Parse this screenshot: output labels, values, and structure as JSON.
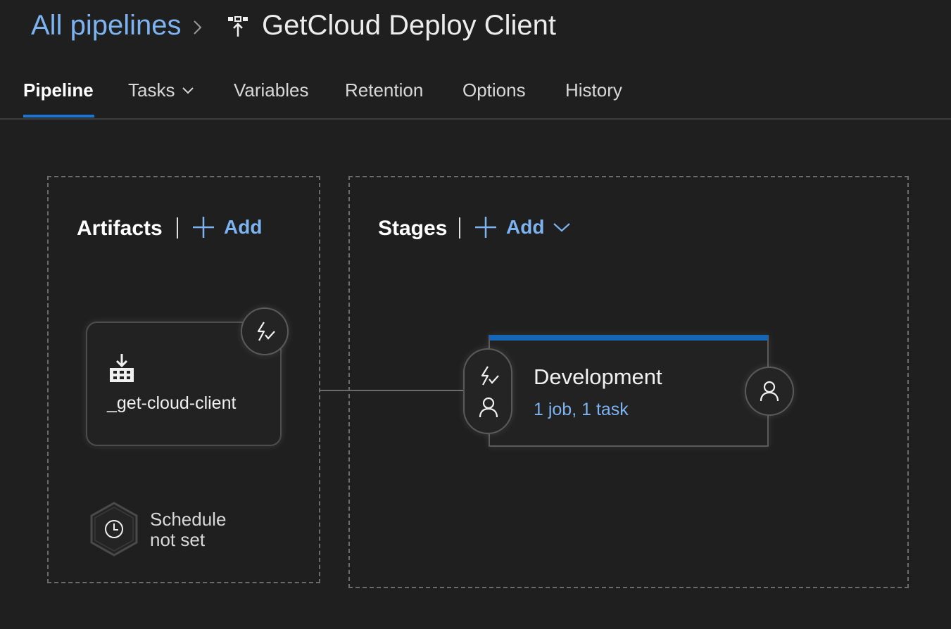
{
  "breadcrumb": {
    "root_label": "All pipelines",
    "separator_icon": "chevron-right-icon",
    "pipeline_icon": "release-pipeline-icon",
    "title": "GetCloud Deploy Client"
  },
  "tabs": [
    {
      "label": "Pipeline",
      "active": true
    },
    {
      "label": "Tasks",
      "has_dropdown": true
    },
    {
      "label": "Variables"
    },
    {
      "label": "Retention"
    },
    {
      "label": "Options"
    },
    {
      "label": "History"
    }
  ],
  "artifacts": {
    "title": "Artifacts",
    "add_label": "Add",
    "items": [
      {
        "name": "_get-cloud-client",
        "icon": "build-artifact-icon",
        "trigger_icon": "continuous-deployment-trigger-icon"
      }
    ],
    "schedule": {
      "line1": "Schedule",
      "line2": "not set",
      "icon": "clock-icon"
    }
  },
  "stages": {
    "title": "Stages",
    "add_label": "Add",
    "items": [
      {
        "name": "Development",
        "summary": "1 job, 1 task",
        "pre_icons": [
          "trigger-icon",
          "pre-approval-person-icon"
        ],
        "post_icon": "post-approval-person-icon"
      }
    ]
  },
  "colors": {
    "background": "#1f1f1f",
    "accent": "#1a76d2",
    "link": "#7cb3f0",
    "stage_bar": "#1566b8"
  }
}
